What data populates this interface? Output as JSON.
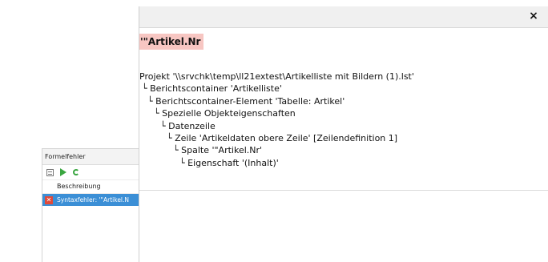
{
  "error_panel": {
    "title": "Formelfehler",
    "toolbar": {
      "icons": [
        "list-icon",
        "run-icon",
        "refresh-icon"
      ]
    },
    "column_header": "Beschreibung",
    "rows": [
      {
        "icon": "error-icon",
        "text": "Syntaxfehler: '\"Artikel.N"
      }
    ]
  },
  "dialog": {
    "close_label": "×",
    "expression": "'\"Artikel.Nr",
    "tree": [
      {
        "prefix": "",
        "text": "Projekt '\\\\srvchk\\temp\\ll21extest\\Artikelliste mit Bildern (1).lst'"
      },
      {
        "prefix": "└ ",
        "text": "Berichtscontainer 'Artikelliste'"
      },
      {
        "prefix": "└ ",
        "text": "Berichtscontainer-Element 'Tabelle: Artikel'"
      },
      {
        "prefix": "└ ",
        "text": "Spezielle Objekteigenschaften"
      },
      {
        "prefix": "└ ",
        "text": "Datenzeile"
      },
      {
        "prefix": "└ ",
        "text": "Zeile 'Artikeldaten obere Zeile' [Zeilendefinition  1]"
      },
      {
        "prefix": "└ ",
        "text": "Spalte '\"Artikel.Nr'"
      },
      {
        "prefix": "└ ",
        "text": "Eigenschaft '(Inhalt)'"
      }
    ]
  },
  "colors": {
    "selection": "#3b8fd6",
    "error_highlight": "#f7c6c2",
    "error_red": "#e04a3a",
    "green": "#3aa640"
  }
}
